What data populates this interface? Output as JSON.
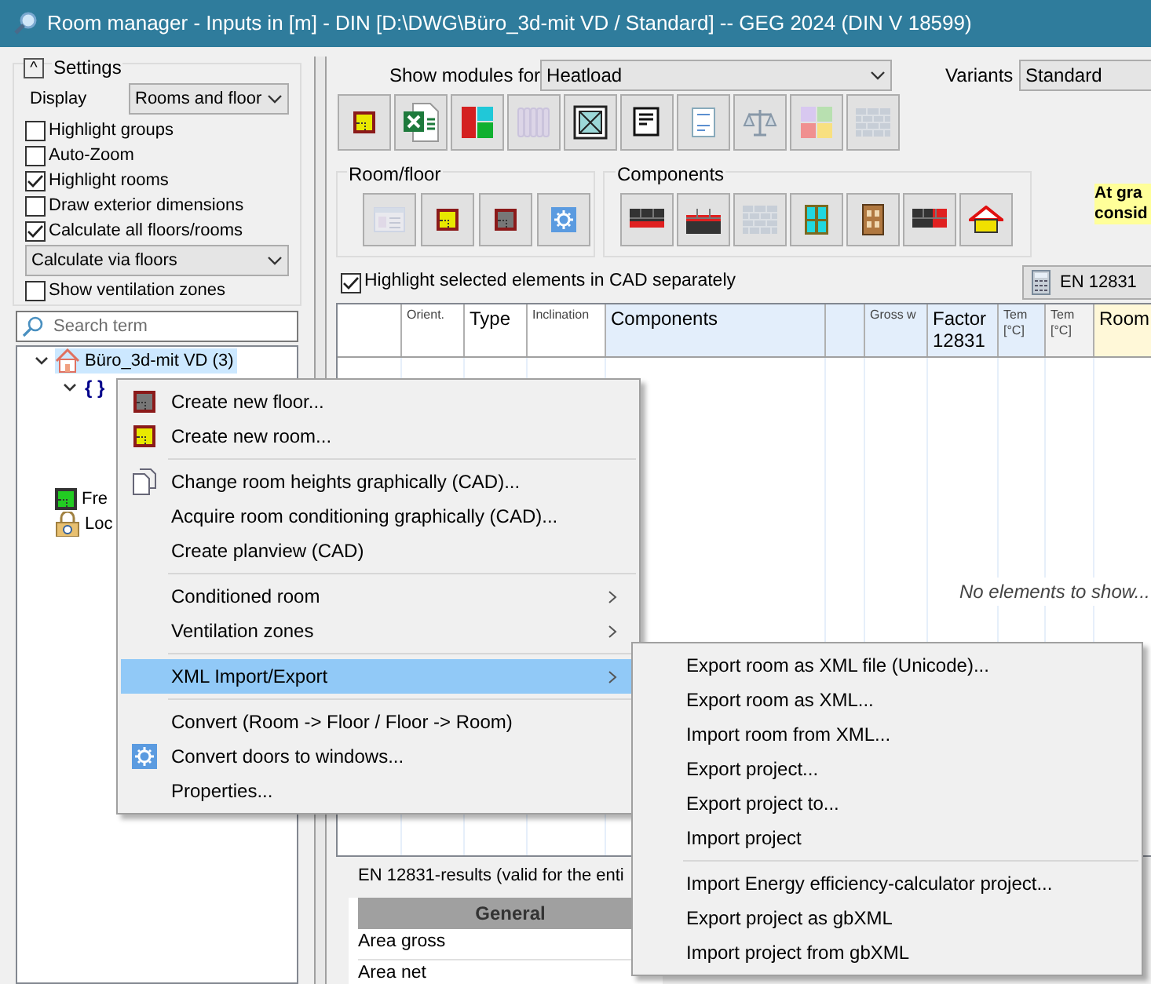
{
  "window": {
    "title": "Room manager - Inputs in [m] - DIN [D:\\DWG\\Büro_3d-mit VD / Standard] -- GEG 2024 (DIN V 18599)"
  },
  "settings": {
    "title": "Settings",
    "collapse_glyph": "^",
    "display_label": "Display",
    "display_value": "Rooms and floor",
    "controls": [
      {
        "kind": "checkbox",
        "label": "Highlight groups",
        "checked": false
      },
      {
        "kind": "checkbox",
        "label": "Auto-Zoom",
        "checked": false
      },
      {
        "kind": "checkbox",
        "label": "Highlight rooms",
        "checked": true
      },
      {
        "kind": "checkbox",
        "label": "Draw exterior dimensions",
        "checked": false
      },
      {
        "kind": "checkbox",
        "label": "Calculate all floors/rooms",
        "checked": true
      },
      {
        "kind": "select",
        "label": "Calculate via floors"
      },
      {
        "kind": "checkbox",
        "label": "Show ventilation zones",
        "checked": false
      }
    ]
  },
  "search": {
    "placeholder": "Search term"
  },
  "tree": [
    {
      "kind": "project",
      "label": "Büro_3d-mit VD (3)",
      "selected": true,
      "expanded": true,
      "children": [
        {
          "kind": "group",
          "label": "{ }",
          "selected": false,
          "expanded": true
        }
      ]
    },
    {
      "kind": "room",
      "label": "Fre",
      "selected": false
    },
    {
      "kind": "locked",
      "label": "Loc",
      "selected": false
    }
  ],
  "modules": {
    "label": "Show modules for",
    "value": "Heatload",
    "variants_label": "Variants",
    "variants_value": "Standard",
    "buttons": [
      {
        "disabled": false
      },
      {
        "disabled": false
      },
      {
        "disabled": false
      },
      {
        "disabled": true
      },
      {
        "disabled": false
      },
      {
        "disabled": false
      },
      {
        "disabled": false
      },
      {
        "disabled": false
      },
      {
        "disabled": false
      },
      {
        "disabled": true
      }
    ]
  },
  "room_floor": {
    "title": "Room/floor",
    "buttons": [
      {
        "disabled": true
      },
      {
        "disabled": false
      },
      {
        "disabled": false
      },
      {
        "disabled": false
      }
    ]
  },
  "components": {
    "title": "Components",
    "buttons": [
      {
        "disabled": false
      },
      {
        "disabled": false
      },
      {
        "disabled": true
      },
      {
        "disabled": false
      },
      {
        "disabled": false
      },
      {
        "disabled": false
      },
      {
        "disabled": false
      }
    ]
  },
  "note": {
    "lines": [
      "At gra",
      "consid"
    ]
  },
  "highlight_checkbox": {
    "label": "Highlight selected elements in CAD separately",
    "checked": true
  },
  "en_button": {
    "label": "EN 12831"
  },
  "table": {
    "columns": [
      {
        "color": "#ffffff"
      },
      {
        "label": "Orient.",
        "kind": "small",
        "color": "#ffffff"
      },
      {
        "label": "Type",
        "kind": "normal",
        "color": "#ffffff"
      },
      {
        "label": "Inclination",
        "kind": "small",
        "color": "#ffffff"
      },
      {
        "label": "Components",
        "kind": "normal",
        "color": "#e3eefb"
      },
      {
        "color": "#e3eefb"
      },
      {
        "label": "Gross w",
        "kind": "small",
        "color": "#e3eefb"
      },
      {
        "label": "Factor 12831",
        "kind": "normal",
        "color": "#e3eefb"
      },
      {
        "label": "Tem [°C]",
        "kind": "small",
        "color": "#e3eefb"
      },
      {
        "label": "Tem [°C]",
        "kind": "small",
        "color": "#f2f2f2"
      },
      {
        "label": "Room",
        "kind": "normal",
        "color": "#fff8d8"
      }
    ],
    "empty_message": "No elements to show..."
  },
  "results": {
    "title": "EN 12831-results (valid for the enti",
    "header": "General",
    "rows": [
      "Area gross",
      "Area net"
    ]
  },
  "context_menu": {
    "items": [
      {
        "kind": "item",
        "label": "Create new floor...",
        "selected": false
      },
      {
        "kind": "item",
        "label": "Create new room...",
        "selected": false
      },
      {
        "kind": "separator"
      },
      {
        "kind": "item",
        "label": "Change room heights graphically (CAD)...",
        "selected": false
      },
      {
        "kind": "item",
        "label": "Acquire room conditioning graphically (CAD)...",
        "selected": false
      },
      {
        "kind": "item",
        "label": "Create planview (CAD)",
        "selected": false
      },
      {
        "kind": "separator"
      },
      {
        "kind": "submenu",
        "label": "Conditioned room",
        "selected": false
      },
      {
        "kind": "submenu",
        "label": "Ventilation zones",
        "selected": false
      },
      {
        "kind": "separator"
      },
      {
        "kind": "submenu",
        "label": "XML Import/Export",
        "selected": true
      },
      {
        "kind": "separator"
      },
      {
        "kind": "item",
        "label": "Convert (Room -> Floor / Floor -> Room)",
        "selected": false
      },
      {
        "kind": "item",
        "label": "Convert doors to windows...",
        "selected": false
      },
      {
        "kind": "item",
        "label": "Properties...",
        "selected": false
      }
    ]
  },
  "submenu": {
    "items": [
      {
        "kind": "item",
        "label": "Export room as XML file (Unicode)..."
      },
      {
        "kind": "item",
        "label": "Export room as XML..."
      },
      {
        "kind": "item",
        "label": "Import room from XML..."
      },
      {
        "kind": "item",
        "label": "Export project..."
      },
      {
        "kind": "item",
        "label": "Export project to..."
      },
      {
        "kind": "item",
        "label": "Import project"
      },
      {
        "kind": "separator"
      },
      {
        "kind": "item",
        "label": "Import Energy efficiency-calculator project..."
      },
      {
        "kind": "item",
        "label": "Export project as gbXML"
      },
      {
        "kind": "item",
        "label": "Import project from gbXML"
      }
    ]
  }
}
